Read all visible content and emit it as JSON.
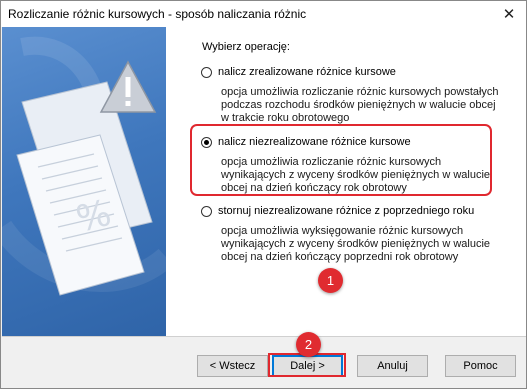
{
  "window": {
    "title": "Rozliczanie różnic kursowych - sposób naliczania różnic",
    "close_glyph": "✕"
  },
  "content": {
    "heading": "Wybierz operację:",
    "options": [
      {
        "label": "nalicz zrealizowane różnice kursowe",
        "checked": false,
        "desc": [
          "opcja umożliwia rozliczanie różnic kursowych powstałych",
          "podczas rozchodu środków pieniężnych w walucie obcej",
          "w trakcie roku obrotowego"
        ]
      },
      {
        "label": "nalicz niezrealizowane różnice kursowe",
        "checked": true,
        "desc": [
          "opcja umożliwia rozliczanie różnic kursowych",
          "wynikających z wyceny środków pieniężnych w walucie",
          "obcej na dzień kończący rok obrotowy"
        ]
      },
      {
        "label": "stornuj niezrealizowane różnice z poprzedniego roku",
        "checked": false,
        "desc": [
          "opcja umożliwia wyksięgowanie różnic kursowych",
          "wynikających z wyceny środków pieniężnych w walucie",
          "obcej na dzień kończący poprzedni rok obrotowy"
        ]
      }
    ]
  },
  "buttons": {
    "back": "< Wstecz",
    "next": "Dalej >",
    "cancel": "Anuluj",
    "help": "Pomoc"
  },
  "annotations": {
    "step1": "1",
    "step2": "2",
    "color": "#e02b30"
  },
  "icons": {
    "panel": [
      "documents-icon",
      "warning-icon"
    ]
  }
}
